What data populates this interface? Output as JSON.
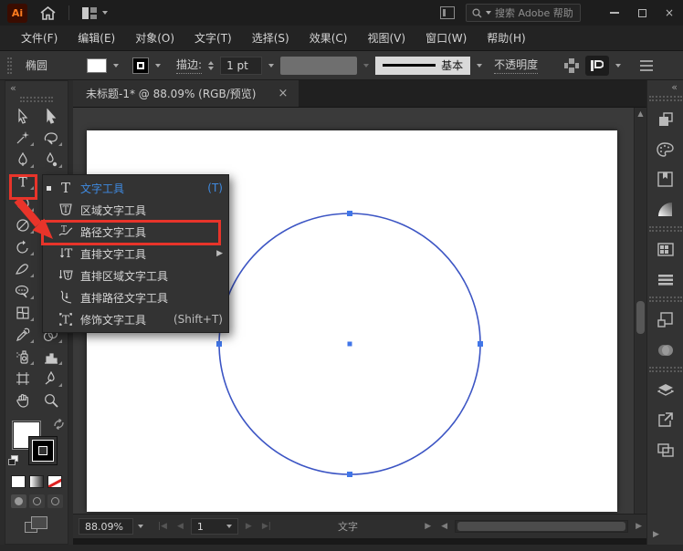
{
  "titlebar": {
    "logo": "Ai",
    "search_placeholder": "搜索 Adobe 帮助"
  },
  "menubar": {
    "items": [
      "文件(F)",
      "编辑(E)",
      "对象(O)",
      "文字(T)",
      "选择(S)",
      "效果(C)",
      "视图(V)",
      "窗口(W)",
      "帮助(H)"
    ]
  },
  "optionsbar": {
    "context_label": "椭圆",
    "stroke_label": "描边:",
    "stroke_width": "1 pt",
    "brush_style": "基本",
    "opacity_label": "不透明度"
  },
  "tabbar": {
    "title": "未标题-1* @ 88.09% (RGB/预览)",
    "close": "×"
  },
  "tool_menu": {
    "items": [
      {
        "label": "文字工具",
        "shortcut": "(T)"
      },
      {
        "label": "区域文字工具",
        "shortcut": ""
      },
      {
        "label": "路径文字工具",
        "shortcut": ""
      },
      {
        "label": "直排文字工具",
        "shortcut": ""
      },
      {
        "label": "直排区域文字工具",
        "shortcut": ""
      },
      {
        "label": "直排路径文字工具",
        "shortcut": ""
      },
      {
        "label": "修饰文字工具",
        "shortcut": "(Shift+T)"
      }
    ]
  },
  "statusbar": {
    "zoom": "88.09%",
    "artboard_number": "1",
    "tool_status": "文字"
  },
  "colors": {
    "annotation_red": "#e8342a",
    "accent_blue": "#3f8ae0",
    "selection_blue": "#4176e8"
  }
}
